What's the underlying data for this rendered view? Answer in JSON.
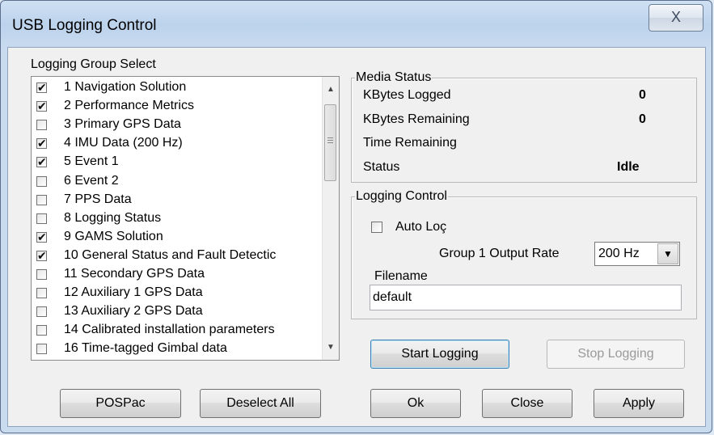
{
  "window": {
    "title": "USB Logging Control",
    "close_glyph": "X"
  },
  "logging_group": {
    "title": "Logging Group Select",
    "items": [
      {
        "label": "1 Navigation Solution",
        "checked": true
      },
      {
        "label": "2 Performance Metrics",
        "checked": true
      },
      {
        "label": "3 Primary GPS Data",
        "checked": false
      },
      {
        "label": "4 IMU Data (200 Hz)",
        "checked": true
      },
      {
        "label": "5 Event 1",
        "checked": true
      },
      {
        "label": "6 Event 2",
        "checked": false
      },
      {
        "label": "7 PPS Data",
        "checked": false
      },
      {
        "label": "8 Logging Status",
        "checked": false
      },
      {
        "label": "9 GAMS Solution",
        "checked": true
      },
      {
        "label": "10 General Status and Fault Detectic",
        "checked": true
      },
      {
        "label": "11 Secondary GPS Data",
        "checked": false
      },
      {
        "label": "12 Auxiliary 1 GPS Data",
        "checked": false
      },
      {
        "label": "13 Auxiliary 2 GPS Data",
        "checked": false
      },
      {
        "label": "14 Calibrated installation parameters",
        "checked": false
      },
      {
        "label": "16 Time-tagged Gimbal data",
        "checked": false
      }
    ]
  },
  "media_status": {
    "title": "Media Status",
    "kbytes_logged_label": "KBytes Logged",
    "kbytes_logged_value": "0",
    "kbytes_remaining_label": "KBytes Remaining",
    "kbytes_remaining_value": "0",
    "time_remaining_label": "Time Remaining",
    "status_label": "Status",
    "status_value": "Idle"
  },
  "logging_control": {
    "title": "Logging Control",
    "auto_log_label": "Auto Loç",
    "auto_log_checked": false,
    "output_rate_label": "Group 1 Output Rate",
    "output_rate_value": "200 Hz",
    "filename_label": "Filename",
    "filename_value": "default"
  },
  "buttons": {
    "start_logging": "Start Logging",
    "stop_logging": "Stop Logging",
    "pospac": "POSPac",
    "deselect_all": "Deselect All",
    "ok": "Ok",
    "close": "Close",
    "apply": "Apply"
  }
}
